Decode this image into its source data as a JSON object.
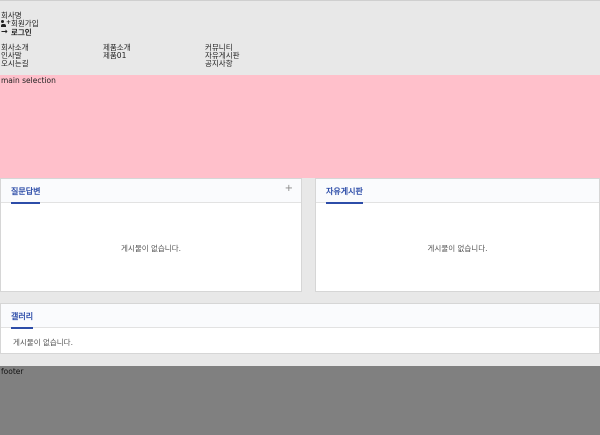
{
  "header": {
    "company_name": "회사명",
    "signup_label": "회원가입",
    "login_label": "로그인",
    "menus": [
      [
        "회사소개",
        "인사말",
        "오시는길"
      ],
      [
        "제품소개",
        "제품01"
      ],
      [
        "커뮤니티",
        "자유게시판",
        "공지사항"
      ]
    ]
  },
  "main_selection": "main selection",
  "boards": {
    "qna": {
      "title": "질문답변",
      "plus": "+",
      "empty": "게시물이 없습니다."
    },
    "free": {
      "title": "자유게시판",
      "empty": "게시물이 없습니다."
    },
    "gallery": {
      "title": "갤러리",
      "empty": "게시물이 없습니다."
    }
  },
  "footer": "footer"
}
